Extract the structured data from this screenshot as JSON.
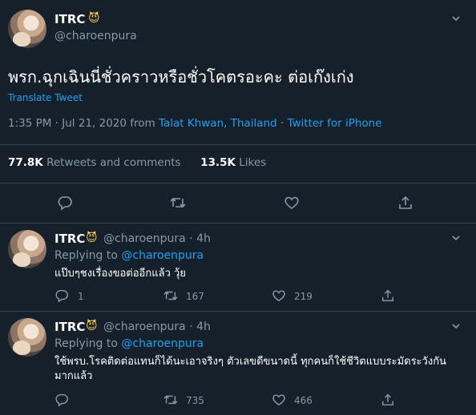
{
  "tweet": {
    "name": "ITRC",
    "emoji": "😈",
    "handle": "@charoenpura",
    "text": "พรก.ฉุกเฉินนี่ชั่วคราวหรือชั่วโคตรอะคะ ต่อเก๊งเก่ง",
    "translate": "Translate Tweet",
    "time": "1:35 PM · Jul 21, 2020 from ",
    "location": "Talat Khwan, Thailand",
    "separator": " · ",
    "source": "Twitter for iPhone",
    "retweets_count": "77.8K",
    "retweets_label": " Retweets and comments",
    "likes_count": "13.5K",
    "likes_label": " Likes"
  },
  "replies": [
    {
      "name": "ITRC",
      "emoji": "😈",
      "handle": "@charoenpura · 4h",
      "replying_prefix": "Replying to ",
      "replying_to": "@charoenpura",
      "text": "แป๊บๆชงเรื่องขอต่ออีกแล้ว วุ้ย",
      "replies": "1",
      "retweets": "167",
      "likes": "219"
    },
    {
      "name": "ITRC",
      "emoji": "😈",
      "handle": "@charoenpura · 4h",
      "replying_prefix": "Replying to ",
      "replying_to": "@charoenpura",
      "text": "ใช้พรบ.โรคติดต่อแทนก็ได้นะเอาจริงๆ ตัวเลขดีขนาดนี้ ทุกคนก็ใช้ชีวิตแบบระมัดระวังกันมากแล้ว",
      "replies": "",
      "retweets": "735",
      "likes": "466"
    }
  ]
}
